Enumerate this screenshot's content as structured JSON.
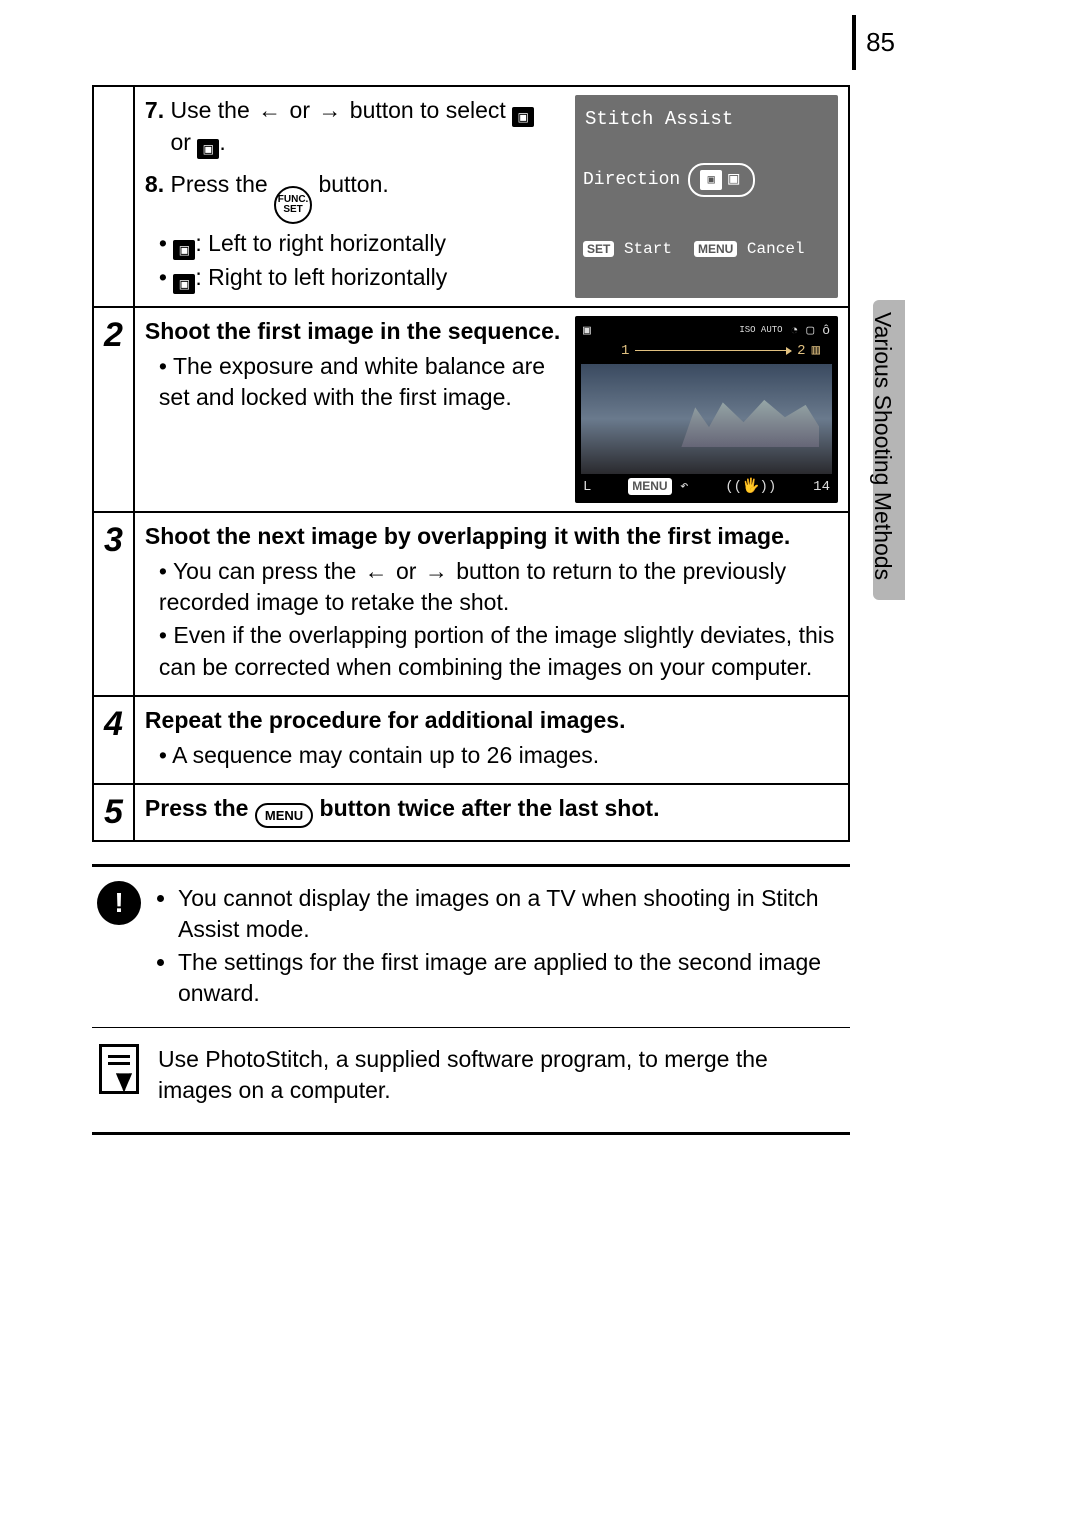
{
  "page_number": "85",
  "side_label": "Various Shooting Methods",
  "step1": {
    "line7_a": "7.",
    "line7_b": "Use the ",
    "line7_c": " or ",
    "line7_d": " button to select ",
    "line7_e": " or ",
    "line7_f": ".",
    "line8_a": "8.",
    "line8_b": "Press the ",
    "line8_c": " button.",
    "bullet_ltr": ": Left to right horizontally",
    "bullet_rtl": ": Right to left horizontally",
    "lcd": {
      "title": "Stitch Assist",
      "direction": "Direction",
      "set": "SET",
      "start": "Start",
      "menu": "MENU",
      "cancel": "Cancel"
    }
  },
  "step2": {
    "num": "2",
    "heading": "Shoot the first image in the sequence.",
    "bullet": "The exposure and white balance are set and locked with the first image.",
    "lcd": {
      "iso": "ISO AUTO",
      "s1": "1",
      "s2": "2",
      "L": "L",
      "menu": "MENU",
      "count": "14"
    }
  },
  "step3": {
    "num": "3",
    "heading": "Shoot the next image by overlapping it with the first image.",
    "bullet1_a": "You can press the ",
    "bullet1_b": " or ",
    "bullet1_c": " button to return to the previously recorded image to retake the shot.",
    "bullet2": "Even if the overlapping portion of the image slightly deviates, this can be corrected when combining the images on your computer."
  },
  "step4": {
    "num": "4",
    "heading": "Repeat the procedure for additional images.",
    "bullet": "A sequence may contain up to 26 images."
  },
  "step5": {
    "num": "5",
    "heading_a": "Press the ",
    "heading_b": " button twice after the last shot.",
    "menu_label": "MENU"
  },
  "notes": {
    "warn1": "You cannot display the images on a TV when shooting in Stitch Assist mode.",
    "warn2": "The settings for the first image are applied to the second image onward.",
    "tip": "Use PhotoStitch, a supplied software program, to merge the images on a computer."
  }
}
